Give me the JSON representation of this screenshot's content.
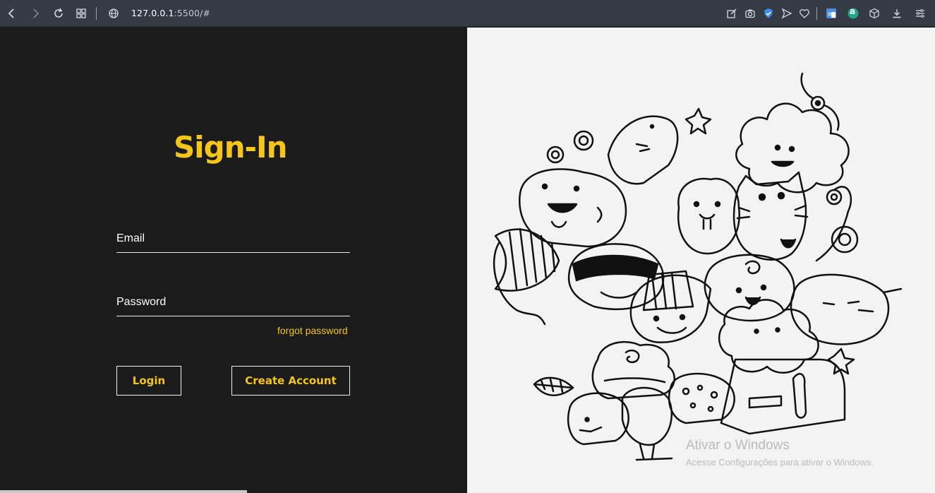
{
  "browser": {
    "url_host": "127.0.0.1",
    "url_rest": ":5500/#",
    "icons": [
      "back-icon",
      "forward-icon",
      "reload-icon",
      "tabs-grid-icon",
      "globe-icon",
      "edit-icon",
      "camera-icon",
      "shield-icon",
      "send-icon",
      "heart-icon",
      "translate-icon",
      "extension-a-icon",
      "cube-icon",
      "download-icon",
      "menu-icon"
    ],
    "extension_letter": "a"
  },
  "signin": {
    "title": "Sign-In",
    "email_label": "Email",
    "password_label": "Password",
    "forgot_label": "forgot password",
    "login_label": "Login",
    "create_label": "Create Account"
  },
  "colors": {
    "accent": "#f5c518",
    "background": "#1b1b1b",
    "chrome": "#353b45"
  },
  "watermark": {
    "line1": "Ativar o Windows",
    "line2": "Acesse Configurações para ativar o Windows."
  }
}
